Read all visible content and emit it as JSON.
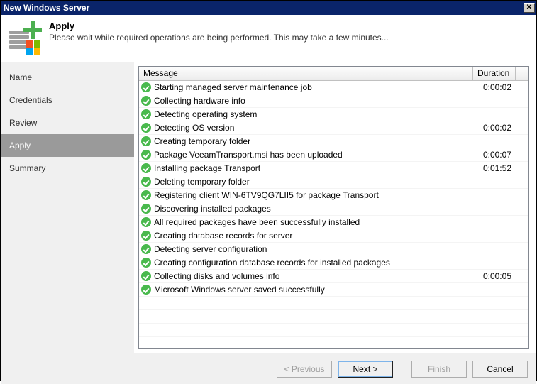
{
  "window": {
    "title": "New Windows Server"
  },
  "header": {
    "title": "Apply",
    "subtitle": "Please wait while required operations are being performed. This may take a few minutes..."
  },
  "sidebar": {
    "steps": [
      {
        "label": "Name",
        "active": false
      },
      {
        "label": "Credentials",
        "active": false
      },
      {
        "label": "Review",
        "active": false
      },
      {
        "label": "Apply",
        "active": true
      },
      {
        "label": "Summary",
        "active": false
      }
    ]
  },
  "grid": {
    "columns": {
      "message": "Message",
      "duration": "Duration"
    },
    "rows": [
      {
        "status": "ok",
        "message": "Starting managed server maintenance job",
        "duration": "0:00:02"
      },
      {
        "status": "ok",
        "message": "Collecting hardware info",
        "duration": ""
      },
      {
        "status": "ok",
        "message": "Detecting operating system",
        "duration": ""
      },
      {
        "status": "ok",
        "message": "Detecting OS version",
        "duration": "0:00:02"
      },
      {
        "status": "ok",
        "message": "Creating temporary folder",
        "duration": ""
      },
      {
        "status": "ok",
        "message": "Package VeeamTransport.msi has been uploaded",
        "duration": "0:00:07"
      },
      {
        "status": "ok",
        "message": "Installing package Transport",
        "duration": "0:01:52"
      },
      {
        "status": "ok",
        "message": "Deleting temporary folder",
        "duration": ""
      },
      {
        "status": "ok",
        "message": "Registering client WIN-6TV9QG7LII5 for package Transport",
        "duration": ""
      },
      {
        "status": "ok",
        "message": "Discovering installed packages",
        "duration": ""
      },
      {
        "status": "ok",
        "message": "All required packages have been successfully installed",
        "duration": ""
      },
      {
        "status": "ok",
        "message": "Creating database records for server",
        "duration": ""
      },
      {
        "status": "ok",
        "message": "Detecting server configuration",
        "duration": ""
      },
      {
        "status": "ok",
        "message": "Creating configuration database records for installed packages",
        "duration": ""
      },
      {
        "status": "ok",
        "message": "Collecting disks and volumes info",
        "duration": "0:00:05"
      },
      {
        "status": "ok",
        "message": "Microsoft Windows server saved successfully",
        "duration": ""
      }
    ],
    "empty_rows": 4
  },
  "footer": {
    "previous": "< Previous",
    "next_prefix": "N",
    "next_suffix": "ext >",
    "finish": "Finish",
    "cancel": "Cancel"
  }
}
